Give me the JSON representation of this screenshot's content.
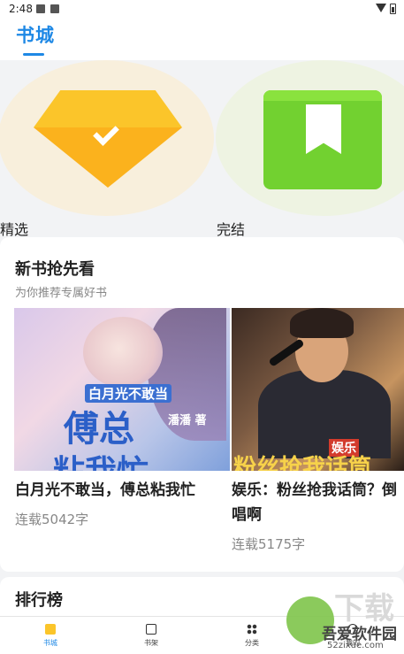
{
  "status_bar": {
    "time": "2:48"
  },
  "header": {
    "title": "书城",
    "accent_color": "#1E88E5"
  },
  "categories": [
    {
      "label": "精选",
      "icon": "diamond-icon"
    },
    {
      "label": "完结",
      "icon": "book-bookmark-icon"
    }
  ],
  "new_books": {
    "title": "新书抢先看",
    "subtitle": "为你推荐专属好书",
    "items": [
      {
        "title": "白月光不敢当，傅总粘我忙",
        "count": "连载5042字",
        "cover_text": {
          "line1": "白月光不敢当",
          "line2": "傅总",
          "author": "潘潘 著",
          "line3": "粘我忙"
        }
      },
      {
        "title": "娱乐：粉丝抢我话筒？倒唱啊",
        "count": "连载5175字",
        "cover_text": {
          "tag": "娱乐",
          "line": "粉丝抢我话筒"
        }
      }
    ]
  },
  "ranking": {
    "title": "排行榜"
  },
  "bottom_nav": [
    {
      "label": "书城",
      "icon": "bookstore-icon",
      "active": true
    },
    {
      "label": "书架",
      "icon": "bookshelf-icon",
      "active": false
    },
    {
      "label": "分类",
      "icon": "category-icon",
      "active": false
    },
    {
      "label": "我的",
      "icon": "mine-icon",
      "active": false
    }
  ],
  "watermark": {
    "text": "吾爱软件园",
    "url_text": "52zixue.com",
    "faded_text": "下载"
  }
}
